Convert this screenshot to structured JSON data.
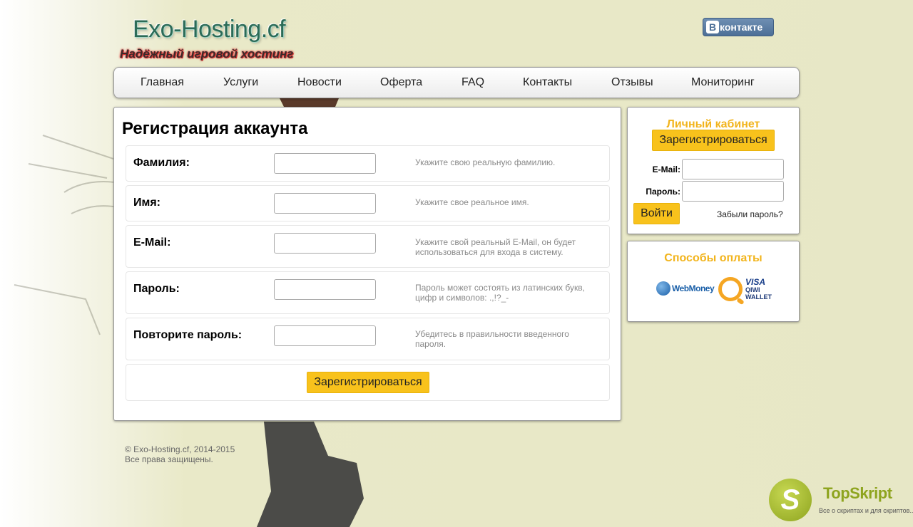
{
  "header": {
    "logo_title": "Exo-Hosting.cf",
    "logo_subtitle": "Надёжный игровой хостинг",
    "vk_label": "контакте",
    "vk_letter": "В"
  },
  "nav": {
    "items": [
      "Главная",
      "Услуги",
      "Новости",
      "Оферта",
      "FAQ",
      "Контакты",
      "Отзывы",
      "Мониторинг"
    ]
  },
  "registration": {
    "title": "Регистрация аккаунта",
    "fields": [
      {
        "label": "Фамилия:",
        "value": "",
        "hint": "Укажите свою реальную фамилию."
      },
      {
        "label": "Имя:",
        "value": "",
        "hint": "Укажите свое реальное имя."
      },
      {
        "label": "E-Mail:",
        "value": "",
        "hint": "Укажите свой реальный E-Mail, он будет использоваться для входа в систему."
      },
      {
        "label": "Пароль:",
        "value": "",
        "hint": "Пароль может состоять из латинских букв, цифр и символов: .,!?_-"
      },
      {
        "label": "Повторите пароль:",
        "value": "",
        "hint": "Убедитесь в правильности введенного пароля."
      }
    ],
    "submit_label": "Зарегистрироваться"
  },
  "account": {
    "title": "Личный кабинет",
    "register_label": "Зарегистрироваться",
    "email_label": "E-Mail:",
    "password_label": "Пароль:",
    "login_label": "Войти",
    "forgot_label": "Забыли пароль?"
  },
  "payment": {
    "title": "Способы оплаты",
    "webmoney_label": "WebMoney",
    "qiwi_visa": "VISA",
    "qiwi_line1": "QIWI",
    "qiwi_line2": "WALLET"
  },
  "footer": {
    "copyright": "© Exo-Hosting.cf, 2014-2015",
    "rights": "Все права защищены."
  },
  "watermark": {
    "letter": "S",
    "name": "TopSkript",
    "tagline": "Все о скриптах и для скриптов..."
  },
  "colors": {
    "accent_yellow": "#f8c21c",
    "side_title": "#f2b41c",
    "vk_blue": "#5b7ba3"
  }
}
